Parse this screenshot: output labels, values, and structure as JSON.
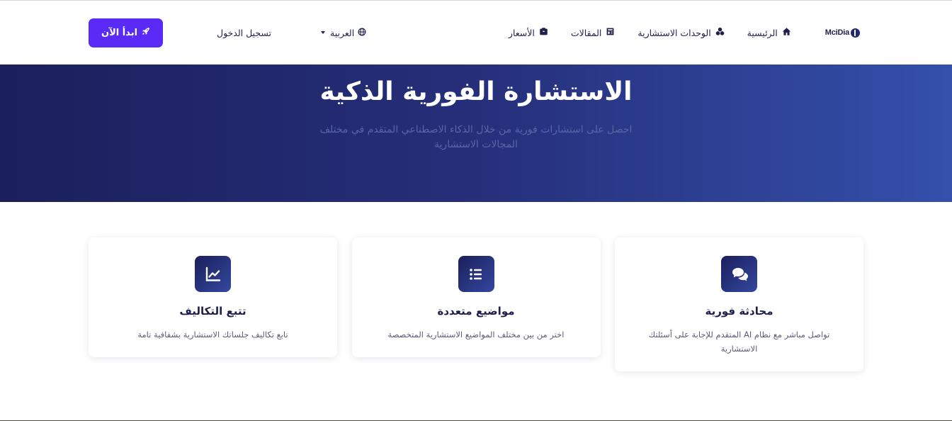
{
  "header": {
    "logo_text": "MciDia",
    "nav": [
      {
        "label": "الرئيسية",
        "icon": "home-icon"
      },
      {
        "label": "الوحدات الاستشارية",
        "icon": "cubes-icon"
      },
      {
        "label": "المقالات",
        "icon": "newspaper-icon"
      },
      {
        "label": "الأسعار",
        "icon": "wallet-icon"
      }
    ],
    "language_label": "العربية",
    "login_label": "تسجيل الدخول",
    "start_label": "ابدأ الآن"
  },
  "hero": {
    "title": "الاستشارة الفورية الذكية",
    "subtitle": "احصل على استشارات فورية من خلال الذكاء الاصطناعي المتقدم في مختلف المجالات الاستشارية"
  },
  "features": [
    {
      "icon": "comments-icon",
      "title": "محادثة فورية",
      "description": "تواصل مباشر مع نظام AI المتقدم للإجابة على أسئلتك الاستشارية"
    },
    {
      "icon": "list-icon",
      "title": "مواضيع متعددة",
      "description": "اختر من بين مختلف المواضيع الاستشارية المتخصصة"
    },
    {
      "icon": "chart-line-icon",
      "title": "تتبع التكاليف",
      "description": "تابع تكاليف جلساتك الاستشارية بشفافية تامة"
    }
  ],
  "colors": {
    "primary_button": "#5a2bf7",
    "hero_start": "#1b1f5c",
    "hero_end": "#3450ab",
    "text_dark": "#1e1f4b"
  }
}
